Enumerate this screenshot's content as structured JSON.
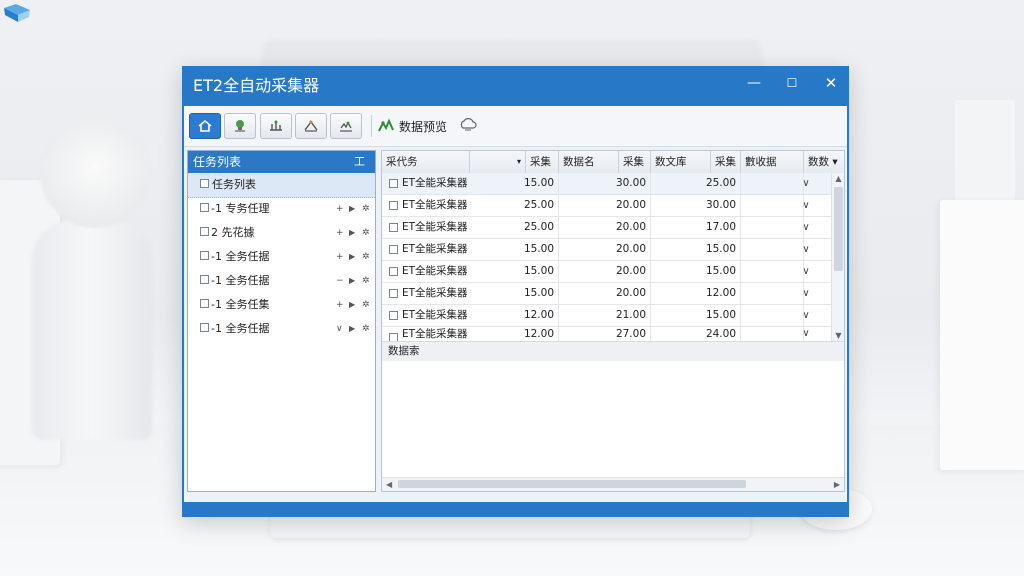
{
  "window": {
    "title": "ET2全自动采集器",
    "controls": {
      "minimize": "—",
      "maximize": "☐",
      "close": "✕"
    }
  },
  "toolbar": {
    "buttons": [
      {
        "icon": "home-icon"
      },
      {
        "icon": "tree-icon"
      },
      {
        "icon": "grid-tool-icon"
      },
      {
        "icon": "peak-icon"
      },
      {
        "icon": "gather-icon"
      }
    ],
    "preview_label": "数据预览",
    "accent": "#2b7bd0"
  },
  "task_panel": {
    "title": "任务列表",
    "title_icon": "工",
    "items": [
      {
        "label": "任务列表"
      },
      {
        "label": "-1 专务任理"
      },
      {
        "label": "2 先花據"
      },
      {
        "label": "-1 全务任据"
      },
      {
        "label": "-1 全务任据"
      },
      {
        "label": "-1 全务任集"
      },
      {
        "label": "-1 全务任据"
      }
    ]
  },
  "grid": {
    "headers": [
      "采代务",
      "▾",
      "采集",
      "数据名",
      "采集",
      "数文库",
      "采集",
      "數收据",
      "数数 ▾"
    ],
    "rows": [
      {
        "name": "ET全能采集器",
        "v1": "15.00",
        "v2": "30.00",
        "v3": "25.00",
        "chev": "∨"
      },
      {
        "name": "ET全能采集器",
        "v1": "25.00",
        "v2": "20.00",
        "v3": "30.00",
        "chev": "∨"
      },
      {
        "name": "ET全能采集器",
        "v1": "25.00",
        "v2": "20.00",
        "v3": "17.00",
        "chev": "∨"
      },
      {
        "name": "ET全能采集器",
        "v1": "15.00",
        "v2": "20.00",
        "v3": "15.00",
        "chev": "∨"
      },
      {
        "name": "ET全能采集器",
        "v1": "15.00",
        "v2": "20.00",
        "v3": "15.00",
        "chev": "∨"
      },
      {
        "name": "ET全能采集器",
        "v1": "15.00",
        "v2": "20.00",
        "v3": "12.00",
        "chev": "∨"
      },
      {
        "name": "ET全能采集器",
        "v1": "12.00",
        "v2": "21.00",
        "v3": "15.00",
        "chev": "∨"
      },
      {
        "name": "ET全能采集器",
        "v1": "12.00",
        "v2": "27.00",
        "v3": "24.00",
        "chev": "∨"
      }
    ],
    "footer_label": "数据索"
  }
}
